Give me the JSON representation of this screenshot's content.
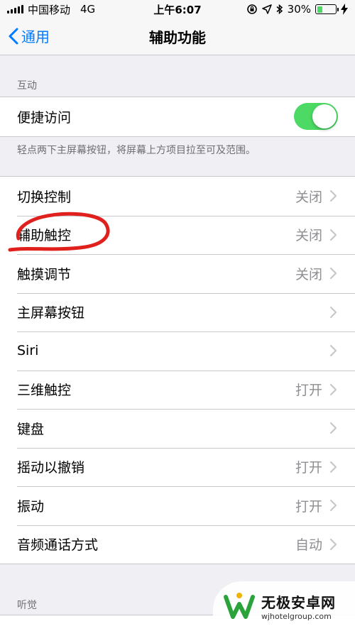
{
  "statusbar": {
    "carrier": "中国移动",
    "network": "4G",
    "time": "上午6:07",
    "battery_percent": "30%",
    "battery_level": 0.3
  },
  "nav": {
    "back_label": "通用",
    "title": "辅助功能"
  },
  "interaction": {
    "header": "互动",
    "reachability": {
      "label": "便捷访问",
      "on": true
    },
    "footer": "轻点两下主屏幕按钮，将屏幕上方项目拉至可及范围。"
  },
  "settings": [
    {
      "label": "切换控制",
      "value": "关闭"
    },
    {
      "label": "辅助触控",
      "value": "关闭"
    },
    {
      "label": "触摸调节",
      "value": "关闭"
    },
    {
      "label": "主屏幕按钮",
      "value": ""
    },
    {
      "label": "Siri",
      "value": ""
    },
    {
      "label": "三维触控",
      "value": "打开"
    },
    {
      "label": "键盘",
      "value": ""
    },
    {
      "label": "摇动以撤销",
      "value": "打开"
    },
    {
      "label": "振动",
      "value": "打开"
    },
    {
      "label": "音频通话方式",
      "value": "自动"
    }
  ],
  "hearing": {
    "header": "听觉"
  },
  "watermark": {
    "title": "无极安卓网",
    "url": "wjhotelgroup.com"
  },
  "colors": {
    "accent": "#007aff",
    "toggle_on": "#4cd964",
    "annotation": "#e0201c"
  }
}
